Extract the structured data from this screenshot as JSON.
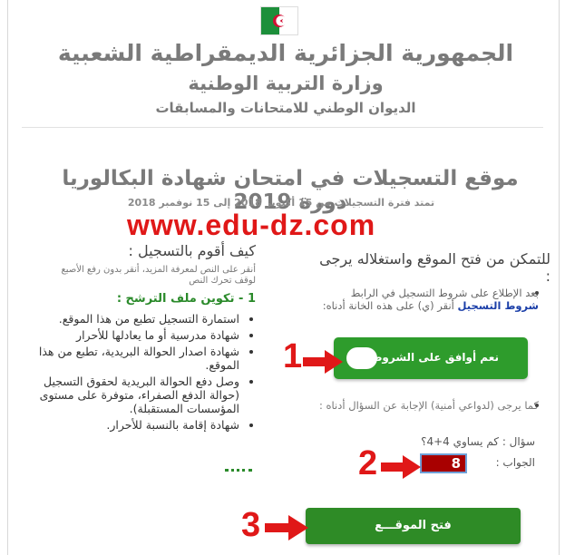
{
  "header": {
    "line1": "الجمهورية الجزائرية الديمقراطية الشعبية",
    "line2": "وزارة التربية الوطنية",
    "line3": "الديوان الوطني للامتحانات والمسابقات"
  },
  "main": {
    "title": "موقع التسجيلات في امتحان شهادة البكالوريا دورة 2019",
    "dates": "تمتد فترة التسجيلات من 15 أكتوبر 2018 إلى 15 نوفمبر 2018",
    "watermark": "www.edu-dz.com"
  },
  "left": {
    "heading": "كيف أقوم بالتسجيل :",
    "note_line1": "أنقر على النص لمعرفة المزيد، أنقر بدون رفع الأصبع",
    "note_line2": "لوقف تحرك النص",
    "step1": "1 - تكوين ملف الترشح :",
    "documents": [
      "استمارة التسجيل تطبع من هذا الموقع.",
      "شهادة مدرسية أو ما يعادلها للأحرار",
      "شهادة اصدار الحوالة البريدية، تطبع من هذا الموقع.",
      "وصل دفع الحوالة البريدية لحقوق التسجيل (حوالة الدفع الصفراء، متوفرة على مستوى المؤسسات المستقبلة).",
      "شهادة إقامة بالنسبة للأحرار."
    ]
  },
  "right": {
    "heading": "للتمكن من فتح الموقع واستغلاله يرجى :",
    "terms_prefix": "بعد الإطلاع على شروط التسجيل في الرابط",
    "terms_link": "شروط التسجيل",
    "terms_suffix": "أنقر (ي) على هذه الخانة أدناه:",
    "agree_button": "نعم أوافق على الشروط",
    "security_text": "كما يرجى (لدواعي أمنية) الإجابة عن السؤال أدناه :",
    "question": "سؤال : كم يساوي 4+4؟",
    "answer_label": "الجواب :",
    "answer_value": "8",
    "open_button": "فتح الموقـــع"
  },
  "annotations": {
    "step_1": "1",
    "step_2": "2",
    "step_3": "3"
  },
  "colors": {
    "accent_green": "#2e9c2c",
    "annotation_red": "#e01818",
    "answer_box": "#a80000",
    "link_blue": "#1a3ea8"
  }
}
